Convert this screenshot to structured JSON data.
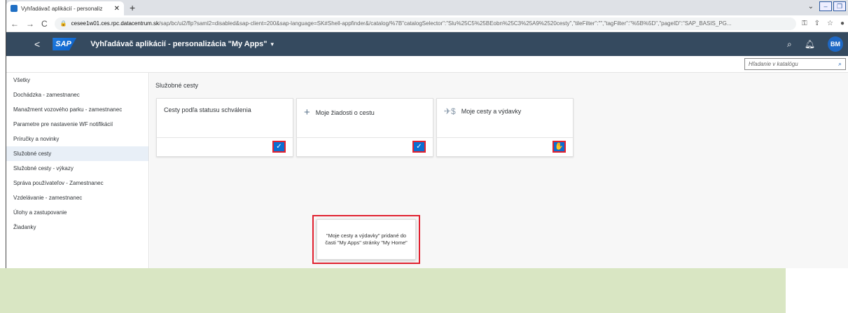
{
  "browser": {
    "tab_title": "Vyhľadávač aplikácií - personaliz",
    "url_host": "cesee1w01.ces.rpc.datacentrum.sk",
    "url_path": "/sap/bc/ui2/flp?saml2=disabled&sap-client=200&sap-language=SK#Shell-appfinder&/catalog/%7B\"catalogSelector\":\"Slu%25C5%25BEobn%25C3%25A9%2520cesty\",\"tileFilter\":\"\",\"tagFilter\":\"%5B%5D\",\"pageID\":\"SAP_BASIS_PG..."
  },
  "shell": {
    "logo": "SAP",
    "title": "Vyhľadávač aplikácií - personalizácia \"My Apps\"",
    "avatar": "BM"
  },
  "search": {
    "placeholder": "Hľadanie v katalógu"
  },
  "sidebar": {
    "items": [
      {
        "label": "Všetky"
      },
      {
        "label": "Dochádzka - zamestnanec"
      },
      {
        "label": "Manažment vozového parku - zamestnanec"
      },
      {
        "label": "Parametre pre nastavenie WF notifikácií"
      },
      {
        "label": "Príručky a novinky"
      },
      {
        "label": "Služobné cesty",
        "selected": true
      },
      {
        "label": "Služobné cesty - výkazy"
      },
      {
        "label": "Správa používateľov - Zamestnanec"
      },
      {
        "label": "Vzdelávanie - zamestnanec"
      },
      {
        "label": "Úlohy a zastupovanie"
      },
      {
        "label": "Žiadanky"
      }
    ]
  },
  "main": {
    "section_title": "Služobné cesty",
    "tiles": [
      {
        "title": "Cesty podľa statusu schválenia",
        "icon": "",
        "checked": true
      },
      {
        "title": "Moje žiadosti o cestu",
        "icon": "plus-icon",
        "checked": true
      },
      {
        "title": "Moje cesty a výdavky",
        "icon": "travel-expense-icon",
        "checked": true
      }
    ],
    "toast": "\"Moje cesty a výdavky\" pridané do časti \"My Apps\" stránky \"My Home\""
  },
  "colors": {
    "shell": "#354a5f",
    "accent": "#0a6ed1",
    "highlight": "#e0212f",
    "bottom_band": "#d9e6c3"
  }
}
